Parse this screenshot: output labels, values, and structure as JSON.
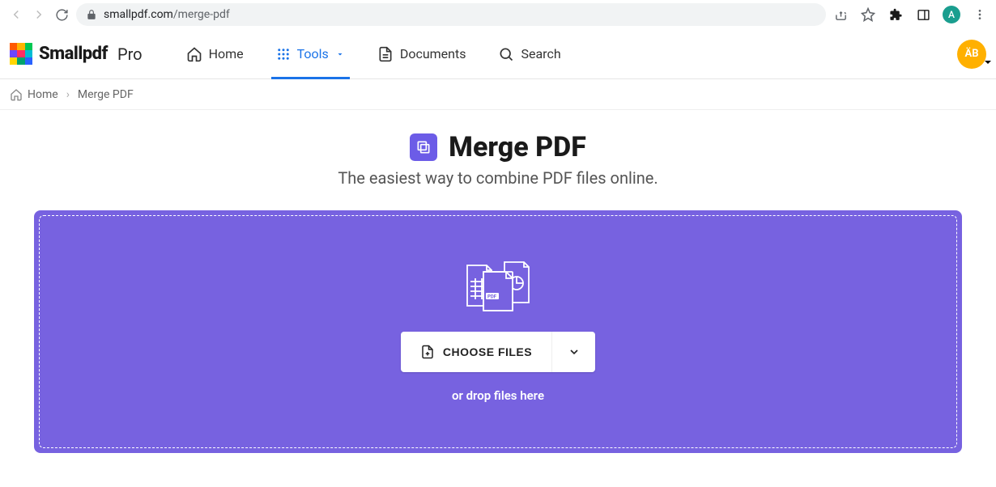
{
  "browser": {
    "url_host": "smallpdf.com",
    "url_path": "/merge-pdf",
    "avatar_initial": "A"
  },
  "brand": {
    "name": "Smallpdf",
    "tier": "Pro"
  },
  "nav": {
    "home": "Home",
    "tools": "Tools",
    "documents": "Documents",
    "search": "Search",
    "avatar_initials": "ÄB"
  },
  "breadcrumb": {
    "home": "Home",
    "current": "Merge PDF"
  },
  "page": {
    "title": "Merge PDF",
    "subtitle": "The easiest way to combine PDF files online.",
    "choose_button": "CHOOSE FILES",
    "drop_hint": "or drop files here"
  }
}
